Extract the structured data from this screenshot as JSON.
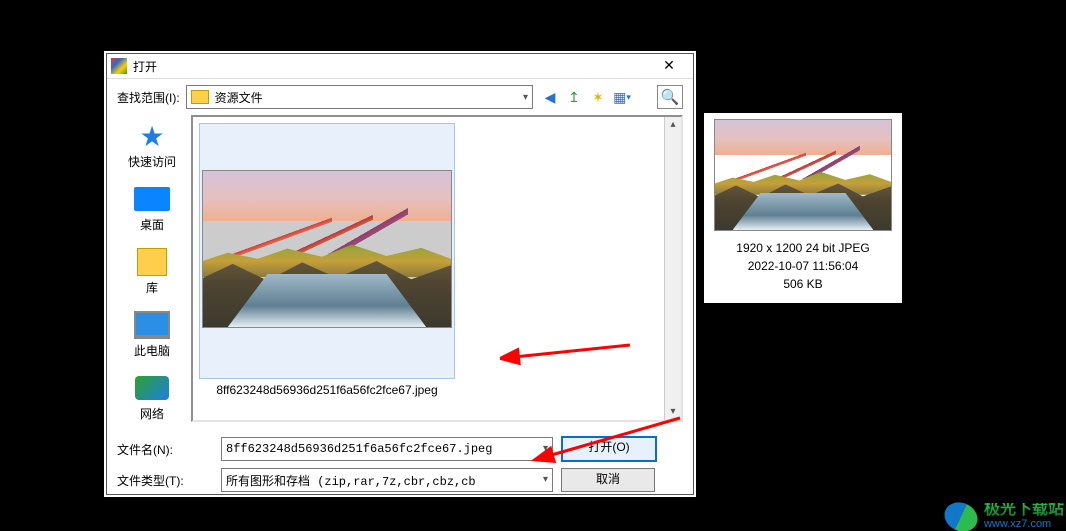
{
  "dialog": {
    "title": "打开",
    "lookin_label": "查找范围(I):",
    "lookin_value": "资源文件",
    "places": {
      "quick": "快速访问",
      "desktop": "桌面",
      "library": "库",
      "thispc": "此电脑",
      "network": "网络"
    },
    "thumbnail_filename": "8ff623248d56936d251f6a56fc2fce67.jpeg",
    "filename_label": "文件名(N):",
    "filename_value": "8ff623248d56936d251f6a56fc2fce67.jpeg",
    "filetype_label": "文件类型(T):",
    "filetype_value": "所有图形和存档 (zip,rar,7z,cbr,cbz,cb",
    "open_button": "打开(O)",
    "cancel_button": "取消"
  },
  "toolbar_icons": {
    "back": "back-icon",
    "up": "up-icon",
    "new": "new-folder-icon",
    "views": "views-icon",
    "magnify": "preview-toggle-icon"
  },
  "preview": {
    "line1": "1920 x 1200   24 bit   JPEG",
    "line2": "2022-10-07 11:56:04",
    "line3": "506 KB"
  },
  "watermark": {
    "name": "极光下载站",
    "url": "www.xz7.com"
  }
}
